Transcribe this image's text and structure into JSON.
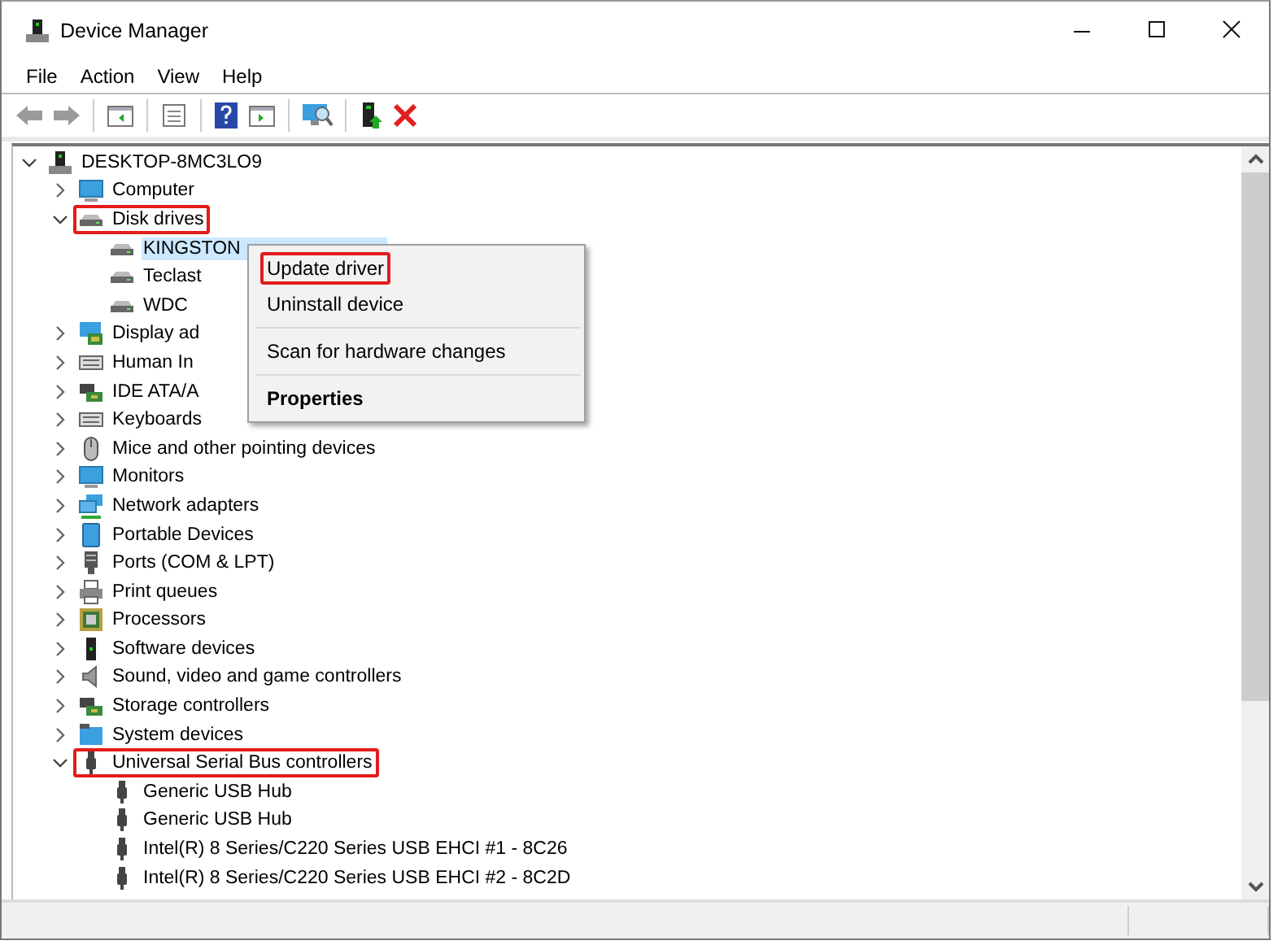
{
  "window": {
    "title": "Device Manager"
  },
  "menu": [
    "File",
    "Action",
    "View",
    "Help"
  ],
  "tree": {
    "label": "DESKTOP-8MC3LO9",
    "kind": "host",
    "expanded": true,
    "selected": false,
    "highlighted": false,
    "children": [
      {
        "label": "Computer",
        "kind": "monitor",
        "expanded": false,
        "selected": false,
        "highlighted": false
      },
      {
        "label": "Disk drives",
        "kind": "disk",
        "expanded": true,
        "selected": false,
        "highlighted": true,
        "children": [
          {
            "label": "KINGSTON",
            "kind": "disk",
            "selected": true,
            "highlighted": false
          },
          {
            "label": "Teclast",
            "kind": "disk",
            "selected": false,
            "highlighted": false
          },
          {
            "label": "WDC",
            "kind": "disk",
            "selected": false,
            "highlighted": false
          }
        ]
      },
      {
        "label": "Display ad",
        "kind": "display",
        "expanded": false,
        "selected": false,
        "highlighted": false
      },
      {
        "label": "Human In",
        "kind": "hid",
        "expanded": false,
        "selected": false,
        "highlighted": false
      },
      {
        "label": "IDE ATA/A",
        "kind": "ide",
        "expanded": false,
        "selected": false,
        "highlighted": false
      },
      {
        "label": "Keyboards",
        "kind": "keyboard",
        "expanded": false,
        "selected": false,
        "highlighted": false
      },
      {
        "label": "Mice and other pointing devices",
        "kind": "mouse",
        "expanded": false,
        "selected": false,
        "highlighted": false
      },
      {
        "label": "Monitors",
        "kind": "monitor",
        "expanded": false,
        "selected": false,
        "highlighted": false
      },
      {
        "label": "Network adapters",
        "kind": "network",
        "expanded": false,
        "selected": false,
        "highlighted": false
      },
      {
        "label": "Portable Devices",
        "kind": "portable",
        "expanded": false,
        "selected": false,
        "highlighted": false
      },
      {
        "label": "Ports (COM & LPT)",
        "kind": "port",
        "expanded": false,
        "selected": false,
        "highlighted": false
      },
      {
        "label": "Print queues",
        "kind": "printer",
        "expanded": false,
        "selected": false,
        "highlighted": false
      },
      {
        "label": "Processors",
        "kind": "cpu",
        "expanded": false,
        "selected": false,
        "highlighted": false
      },
      {
        "label": "Software devices",
        "kind": "tower",
        "expanded": false,
        "selected": false,
        "highlighted": false
      },
      {
        "label": "Sound, video and game controllers",
        "kind": "speaker",
        "expanded": false,
        "selected": false,
        "highlighted": false
      },
      {
        "label": "Storage controllers",
        "kind": "storage",
        "expanded": false,
        "selected": false,
        "highlighted": false
      },
      {
        "label": "System devices",
        "kind": "folder",
        "expanded": false,
        "selected": false,
        "highlighted": false
      },
      {
        "label": "Universal Serial Bus controllers",
        "kind": "usb",
        "expanded": true,
        "selected": false,
        "highlighted": true,
        "children": [
          {
            "label": "Generic USB Hub",
            "kind": "usb",
            "selected": false,
            "highlighted": false
          },
          {
            "label": "Generic USB Hub",
            "kind": "usb",
            "selected": false,
            "highlighted": false
          },
          {
            "label": "Intel(R) 8 Series/C220 Series USB EHCI #1 - 8C26",
            "kind": "usb",
            "selected": false,
            "highlighted": false
          },
          {
            "label": "Intel(R) 8 Series/C220 Series USB EHCI #2 - 8C2D",
            "kind": "usb",
            "selected": false,
            "highlighted": false
          }
        ]
      }
    ]
  },
  "context_menu": {
    "items": [
      {
        "kind": "item",
        "label": "Update driver",
        "bold": false,
        "highlighted": true
      },
      {
        "kind": "item",
        "label": "Uninstall device",
        "bold": false,
        "highlighted": false
      },
      {
        "kind": "separator"
      },
      {
        "kind": "item",
        "label": "Scan for hardware changes",
        "bold": false,
        "highlighted": false
      },
      {
        "kind": "separator"
      },
      {
        "kind": "item",
        "label": "Properties",
        "bold": true,
        "highlighted": false
      }
    ]
  }
}
